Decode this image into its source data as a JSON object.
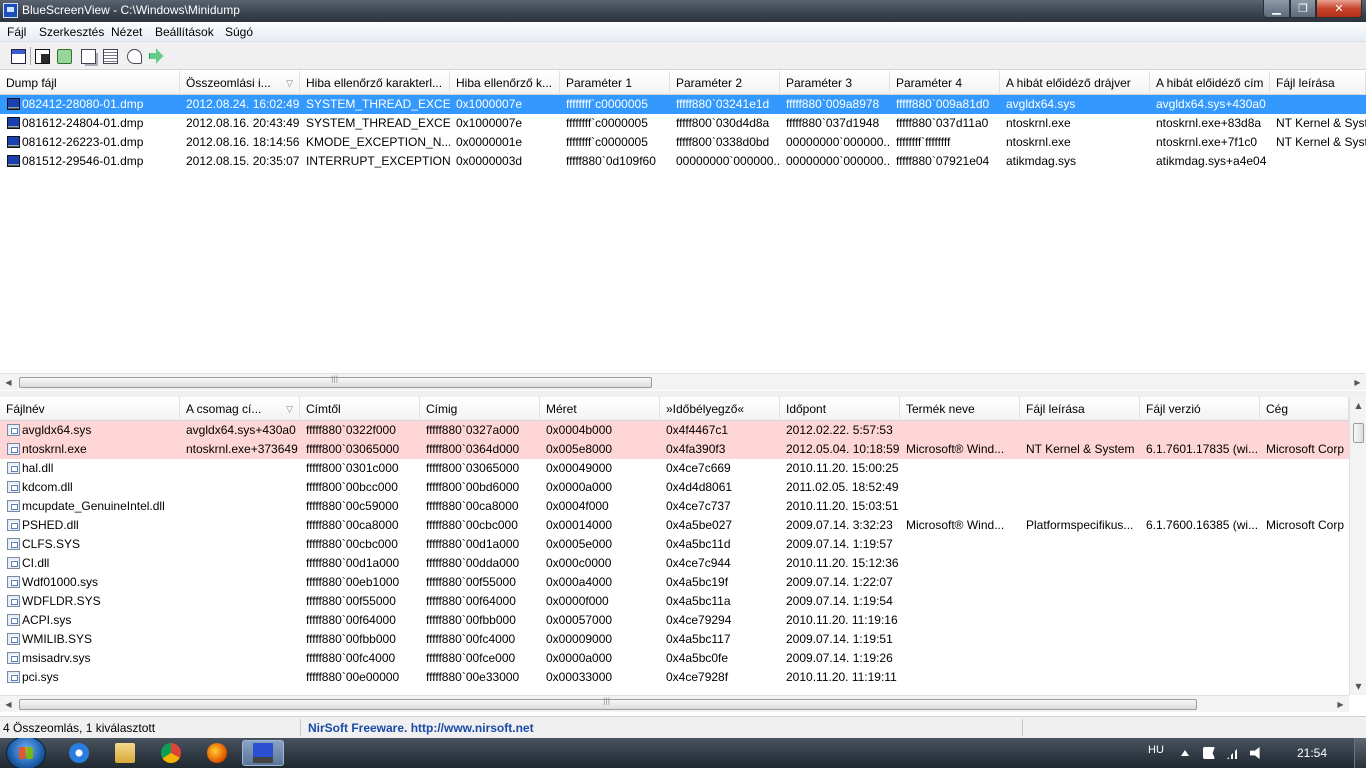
{
  "window": {
    "title": "BlueScreenView  -  C:\\Windows\\Minidump",
    "min_label": "▁",
    "max_label": "❐",
    "close_label": "✕"
  },
  "menu": [
    "Fájl",
    "Szerkesztés",
    "Nézet",
    "Beállítások",
    "Súgó"
  ],
  "toolbar": {
    "icons": [
      "window-icon",
      "save-icon",
      "refresh-icon",
      "copy-icon",
      "properties-icon",
      "find-icon",
      "exit-icon"
    ]
  },
  "crash_list": {
    "columns": [
      "Dump fájl",
      "Összeomlási i...",
      "Hiba ellenőrző karakterl...",
      "Hiba ellenőrző k...",
      "Paraméter 1",
      "Paraméter 2",
      "Paraméter 3",
      "Paraméter 4",
      "A hibát előidéző drájver",
      "A hibát előidéző cím",
      "Fájl leírása"
    ],
    "sort_indicator": "▽",
    "rows": [
      [
        "082412-28080-01.dmp",
        "2012.08.24. 16:02:49",
        "SYSTEM_THREAD_EXCE...",
        "0x1000007e",
        "ffffffff`c0000005",
        "fffff880`03241e1d",
        "fffff880`009a8978",
        "fffff880`009a81d0",
        "avgldx64.sys",
        "avgldx64.sys+430a0",
        ""
      ],
      [
        "081612-24804-01.dmp",
        "2012.08.16. 20:43:49",
        "SYSTEM_THREAD_EXCE...",
        "0x1000007e",
        "ffffffff`c0000005",
        "fffff800`030d4d8a",
        "fffff880`037d1948",
        "fffff880`037d11a0",
        "ntoskrnl.exe",
        "ntoskrnl.exe+83d8a",
        "NT Kernel & System"
      ],
      [
        "081612-26223-01.dmp",
        "2012.08.16. 18:14:56",
        "KMODE_EXCEPTION_N...",
        "0x0000001e",
        "ffffffff`c0000005",
        "fffff800`0338d0bd",
        "00000000`000000...",
        "ffffffff`ffffffff",
        "ntoskrnl.exe",
        "ntoskrnl.exe+7f1c0",
        "NT Kernel & System"
      ],
      [
        "081512-29546-01.dmp",
        "2012.08.15. 20:35:07",
        "INTERRUPT_EXCEPTION...",
        "0x0000003d",
        "fffff880`0d109f60",
        "00000000`000000...",
        "00000000`000000...",
        "fffff880`07921e04",
        "atikmdag.sys",
        "atikmdag.sys+a4e04",
        ""
      ]
    ],
    "selected_row": 0
  },
  "driver_list": {
    "columns": [
      "Fájlnév",
      "A csomag cí...",
      "Címtől",
      "Címig",
      "Méret",
      "»Időbélyegző«",
      "Időpont",
      "Termék neve",
      "Fájl leírása",
      "Fájl verzió",
      "Cég"
    ],
    "sort_indicator": "▽",
    "rows": [
      [
        "avgldx64.sys",
        "avgldx64.sys+430a0",
        "fffff880`0322f000",
        "fffff880`0327a000",
        "0x0004b000",
        "0x4f4467c1",
        "2012.02.22. 5:57:53",
        "",
        "",
        "",
        ""
      ],
      [
        "ntoskrnl.exe",
        "ntoskrnl.exe+373649",
        "fffff800`03065000",
        "fffff800`0364d000",
        "0x005e8000",
        "0x4fa390f3",
        "2012.05.04. 10:18:59",
        "Microsoft® Wind...",
        "NT Kernel & System",
        "6.1.7601.17835 (wi...",
        "Microsoft Corp"
      ],
      [
        "hal.dll",
        "",
        "fffff800`0301c000",
        "fffff800`03065000",
        "0x00049000",
        "0x4ce7c669",
        "2010.11.20. 15:00:25",
        "",
        "",
        "",
        ""
      ],
      [
        "kdcom.dll",
        "",
        "fffff800`00bcc000",
        "fffff800`00bd6000",
        "0x0000a000",
        "0x4d4d8061",
        "2011.02.05. 18:52:49",
        "",
        "",
        "",
        ""
      ],
      [
        "mcupdate_GenuineIntel.dll",
        "",
        "fffff880`00c59000",
        "fffff880`00ca8000",
        "0x0004f000",
        "0x4ce7c737",
        "2010.11.20. 15:03:51",
        "",
        "",
        "",
        ""
      ],
      [
        "PSHED.dll",
        "",
        "fffff880`00ca8000",
        "fffff880`00cbc000",
        "0x00014000",
        "0x4a5be027",
        "2009.07.14. 3:32:23",
        "Microsoft® Wind...",
        "Platformspecifikus...",
        "6.1.7600.16385 (wi...",
        "Microsoft Corp"
      ],
      [
        "CLFS.SYS",
        "",
        "fffff880`00cbc000",
        "fffff880`00d1a000",
        "0x0005e000",
        "0x4a5bc11d",
        "2009.07.14. 1:19:57",
        "",
        "",
        "",
        ""
      ],
      [
        "CI.dll",
        "",
        "fffff880`00d1a000",
        "fffff880`00dda000",
        "0x000c0000",
        "0x4ce7c944",
        "2010.11.20. 15:12:36",
        "",
        "",
        "",
        ""
      ],
      [
        "Wdf01000.sys",
        "",
        "fffff880`00eb1000",
        "fffff880`00f55000",
        "0x000a4000",
        "0x4a5bc19f",
        "2009.07.14. 1:22:07",
        "",
        "",
        "",
        ""
      ],
      [
        "WDFLDR.SYS",
        "",
        "fffff880`00f55000",
        "fffff880`00f64000",
        "0x0000f000",
        "0x4a5bc11a",
        "2009.07.14. 1:19:54",
        "",
        "",
        "",
        ""
      ],
      [
        "ACPI.sys",
        "",
        "fffff880`00f64000",
        "fffff880`00fbb000",
        "0x00057000",
        "0x4ce79294",
        "2010.11.20. 11:19:16",
        "",
        "",
        "",
        ""
      ],
      [
        "WMILIB.SYS",
        "",
        "fffff880`00fbb000",
        "fffff880`00fc4000",
        "0x00009000",
        "0x4a5bc117",
        "2009.07.14. 1:19:51",
        "",
        "",
        "",
        ""
      ],
      [
        "msisadrv.sys",
        "",
        "fffff880`00fc4000",
        "fffff880`00fce000",
        "0x0000a000",
        "0x4a5bc0fe",
        "2009.07.14. 1:19:26",
        "",
        "",
        "",
        ""
      ],
      [
        "pci.sys",
        "",
        "fffff880`00e00000",
        "fffff880`00e33000",
        "0x00033000",
        "0x4ce7928f",
        "2010.11.20. 11:19:11",
        "",
        "",
        "",
        ""
      ]
    ],
    "highlighted_rows": [
      0,
      1
    ]
  },
  "status": {
    "count_text": "4 Összeomlás, 1 kiválasztott",
    "freeware_text": "NirSoft Freeware.  http://www.nirsoft.net"
  },
  "taskbar": {
    "apps": [
      "internet-explorer-icon",
      "explorer-folder-icon",
      "chrome-icon",
      "firefox-icon",
      "bluescreenview-icon"
    ],
    "active_app": 4,
    "language": "HU",
    "clock": "21:54"
  },
  "colors": {
    "selection": "#3399ff",
    "driver_highlight": "#ffd6d6",
    "freeware_link": "#1a4aa8"
  }
}
